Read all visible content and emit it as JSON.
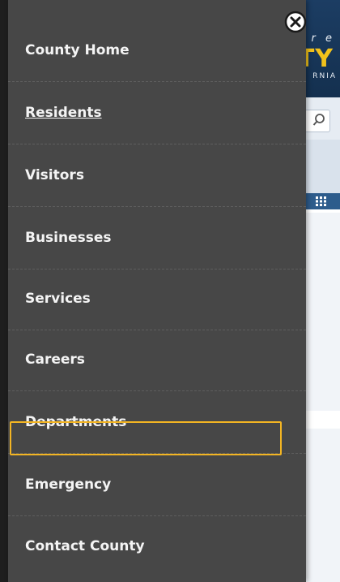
{
  "menu": {
    "items": [
      {
        "label": "County Home"
      },
      {
        "label": "Residents"
      },
      {
        "label": "Visitors"
      },
      {
        "label": "Businesses"
      },
      {
        "label": "Services"
      },
      {
        "label": "Careers"
      },
      {
        "label": "Departments"
      },
      {
        "label": "Emergency"
      },
      {
        "label": "Contact County"
      }
    ],
    "close_icon": "close-circle-icon",
    "underlined_item": "Residents",
    "focused_item": "Departments",
    "colors": {
      "background": "#474747",
      "text": "#f4f4f4",
      "focus_outline": "#f3b523",
      "divider": "#5e5e5e"
    }
  },
  "background_page": {
    "header_tagline": "r e",
    "header_logo": "TY",
    "header_state": "RNIA",
    "search_icon": "magnifier-icon",
    "nav_icon": "grid-icon",
    "colors": {
      "header": "#1c3d63",
      "logo": "#f2c21b"
    }
  }
}
